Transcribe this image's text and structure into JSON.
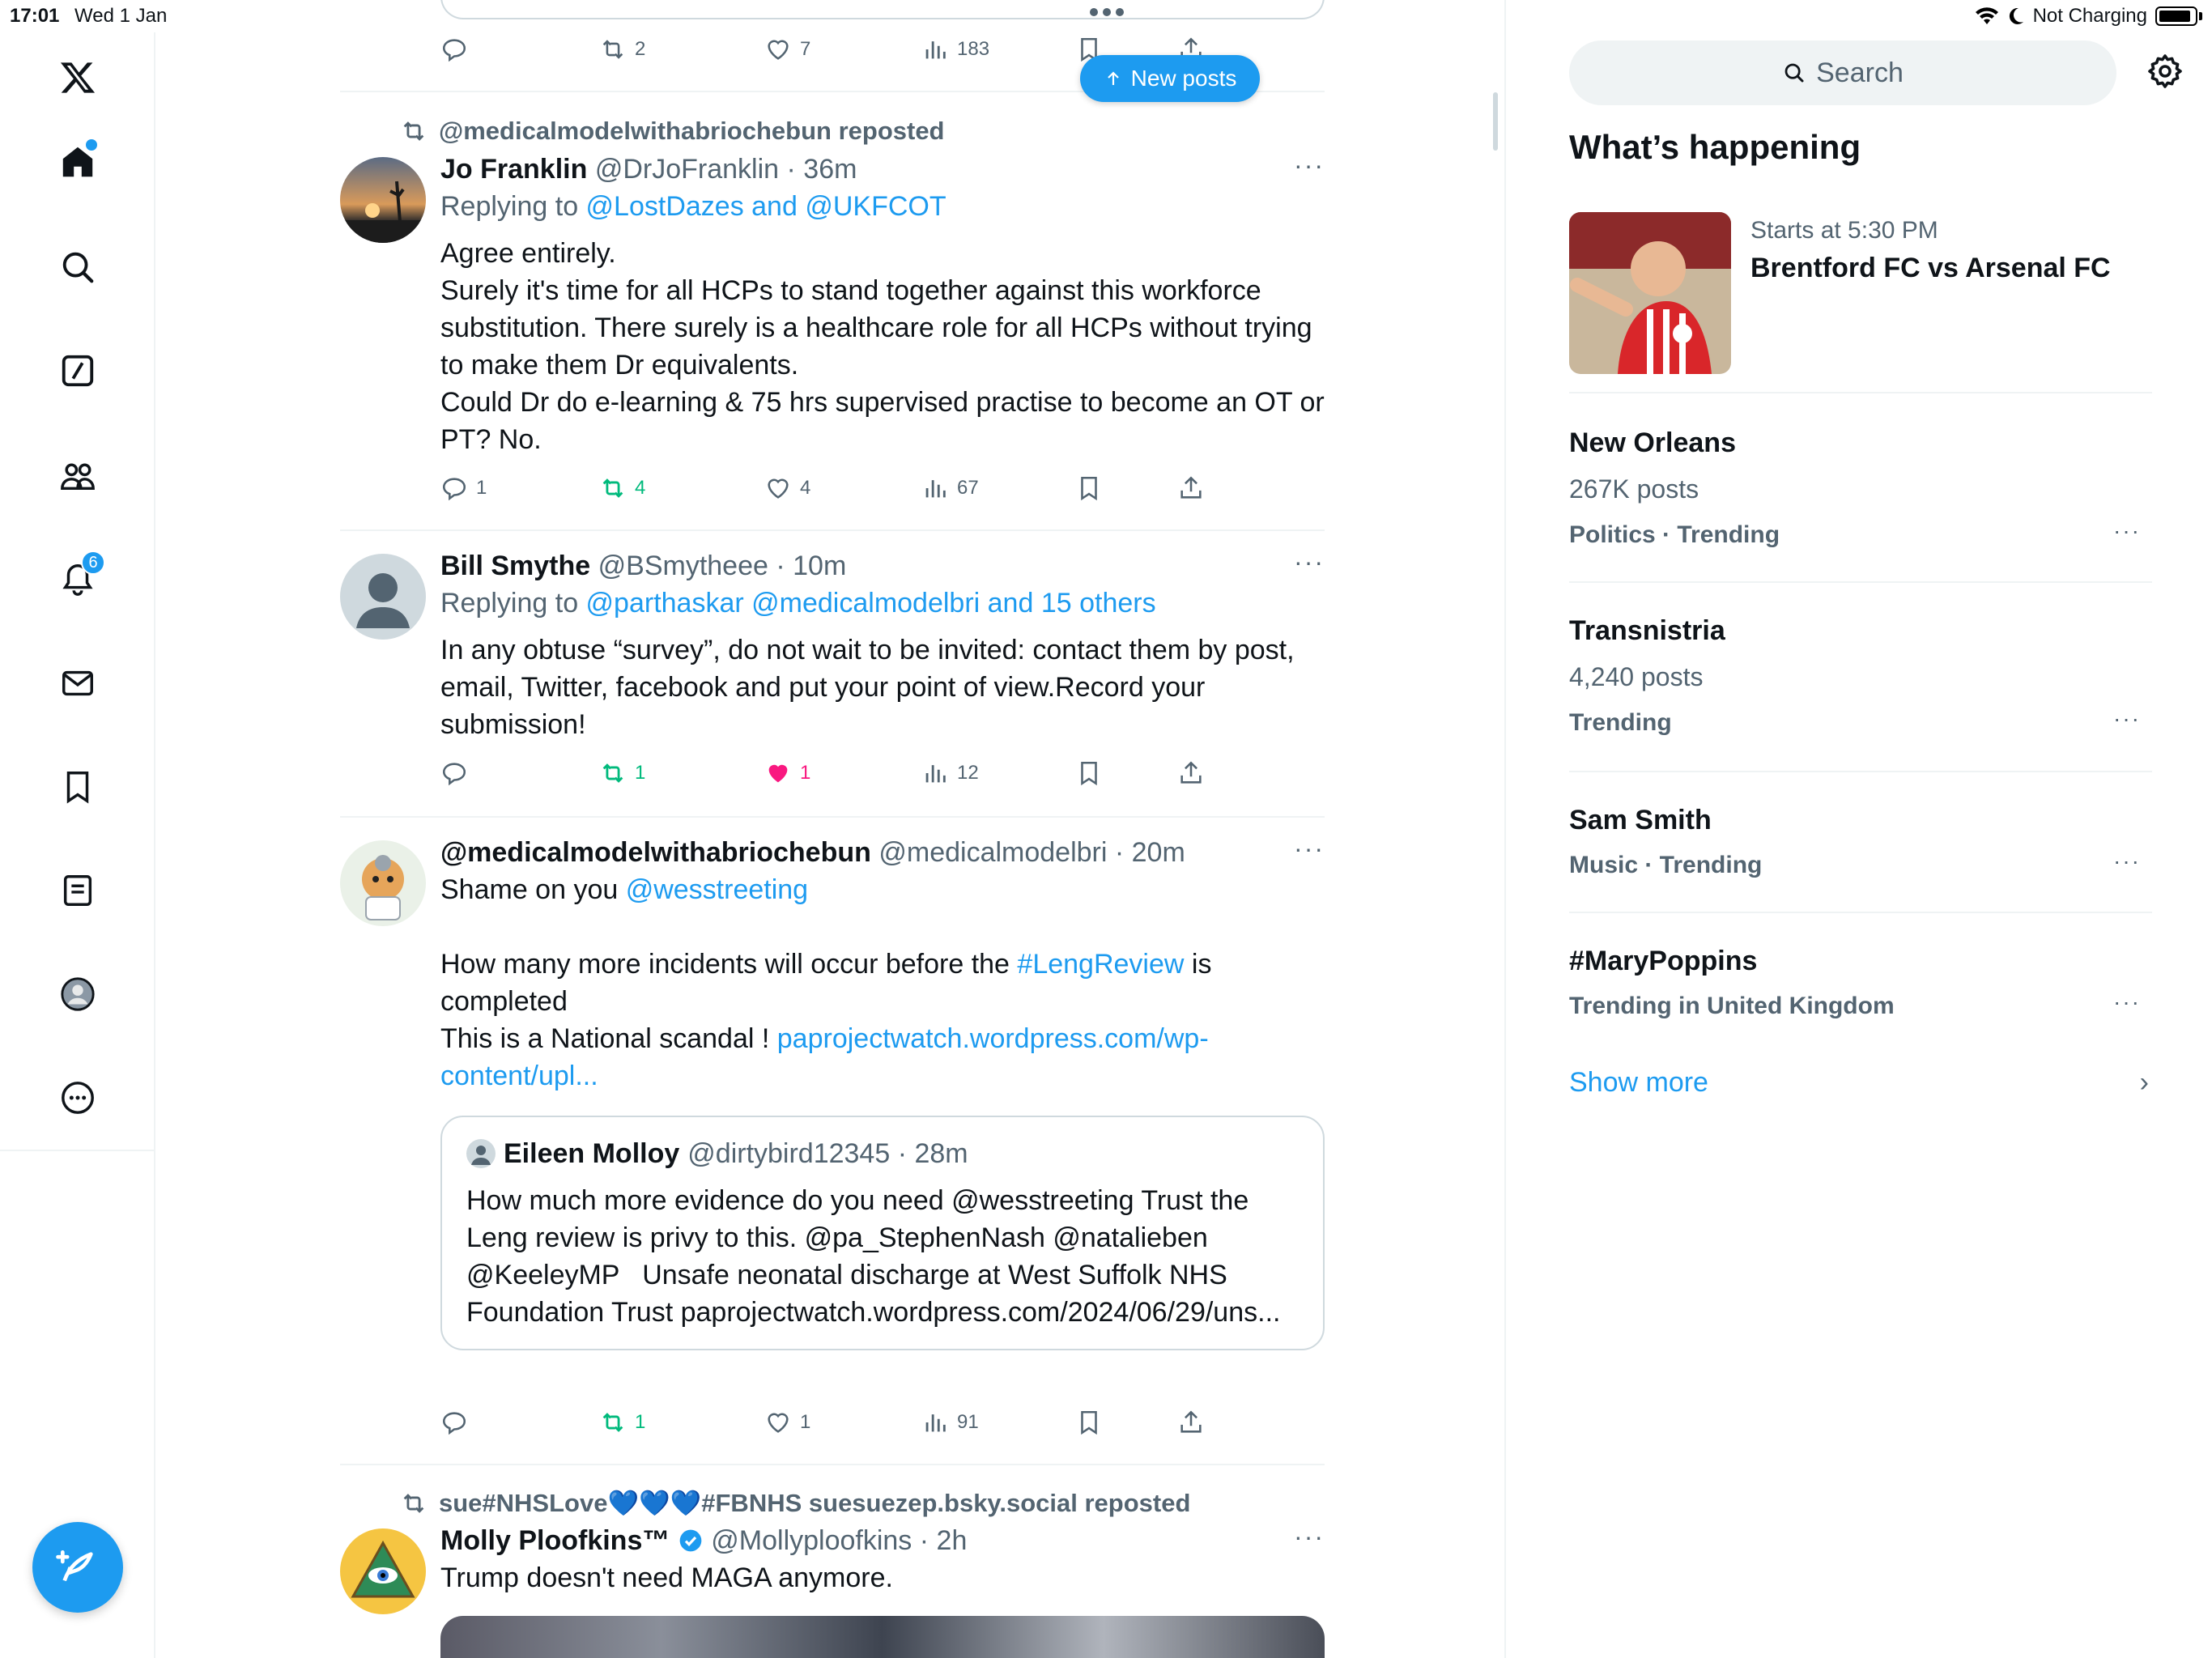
{
  "status": {
    "time": "17:01",
    "date": "Wed 1 Jan",
    "charging": "Not Charging"
  },
  "colors": {
    "accent": "#1d9bf0",
    "retweet": "#00ba7c",
    "like": "#f91880",
    "text": "#0f1419",
    "muted": "#536471"
  },
  "nav": {
    "items": [
      "x-logo-icon",
      "home-icon",
      "search-icon",
      "grok-icon",
      "communities-icon",
      "notifications-icon",
      "messages-icon",
      "bookmarks-icon",
      "lists-icon",
      "profile-icon",
      "more-icon"
    ],
    "notifications_badge": "6",
    "compose_icon": "compose-icon"
  },
  "feed": {
    "new_posts_label": "New posts",
    "top_post": {
      "retweets": "2",
      "likes": "7",
      "views": "183"
    },
    "posts": [
      {
        "repost_by": "@medicalmodelwithabriochebun reposted",
        "name": "Jo Franklin",
        "handle": "@DrJoFranklin",
        "time": "36m",
        "replying_prefix": "Replying to ",
        "replying_to": "@LostDazes and @UKFCOT",
        "text": "Agree entirely.\nSurely it's time for all HCPs to stand together against this workforce substitution. There surely is a healthcare role for all HCPs without trying to make them Dr equivalents.\nCould Dr do e-learning & 75 hrs supervised practise to become an OT or PT? No.",
        "replies": "1",
        "retweets": "4",
        "likes": "4",
        "views": "67"
      },
      {
        "name": "Bill Smythe",
        "handle": "@BSmytheee",
        "time": "10m",
        "replying_prefix": "Replying to ",
        "replying_to": "@parthaskar @medicalmodelbri and 15 others",
        "text": "In any obtuse “survey”, do not wait to be invited: contact them by post, email, Twitter, facebook and put your point of view.Record your submission!",
        "replies": "",
        "retweets": "1",
        "likes": "1",
        "views": "12"
      },
      {
        "name": "@medicalmodelwithabriochebun",
        "handle": "@medicalmodelbri",
        "time": "20m",
        "line1_prefix": "Shame on you ",
        "line1_mention": "@wesstreeting",
        "line2_prefix": "How many more incidents will occur before the ",
        "line2_hashtag": "#LengReview",
        "line2_suffix": " is completed",
        "line3_prefix": "This is a National scandal ! ",
        "line3_link": "paprojectwatch.wordpress.com/wp-content/upl...",
        "quote": {
          "name": "Eileen Molloy",
          "handle": "@dirtybird12345",
          "time": "28m",
          "text": "How much more evidence do you need @wesstreeting Trust the Leng review is privy to this. @pa_StephenNash @natalieben @KeeleyMP   Unsafe neonatal discharge at West Suffolk NHS Foundation Trust paprojectwatch.wordpress.com/2024/06/29/uns..."
        },
        "replies": "",
        "retweets": "1",
        "likes": "1",
        "views": "91"
      },
      {
        "repost_by": "sue#NHSLove💙💙💙#FBNHS suesuezep.bsky.social reposted",
        "name": "Molly Ploofkins™",
        "handle": "@Mollyploofkins",
        "time": "2h",
        "text": "Trump doesn't need MAGA anymore."
      }
    ]
  },
  "right": {
    "search_placeholder": "Search",
    "section_title": "What’s happening",
    "event": {
      "meta": "Starts at 5:30 PM",
      "title": "Brentford FC vs Arsenal FC"
    },
    "trends": [
      {
        "name": "New Orleans",
        "count": "267K posts",
        "category": "Politics · Trending"
      },
      {
        "name": "Transnistria",
        "count": "4,240 posts",
        "category": "Trending"
      },
      {
        "name": "Sam Smith",
        "count": "",
        "category": "Music · Trending"
      },
      {
        "name": "#MaryPoppins",
        "count": "",
        "category": "Trending in United Kingdom"
      }
    ],
    "show_more": "Show more"
  }
}
